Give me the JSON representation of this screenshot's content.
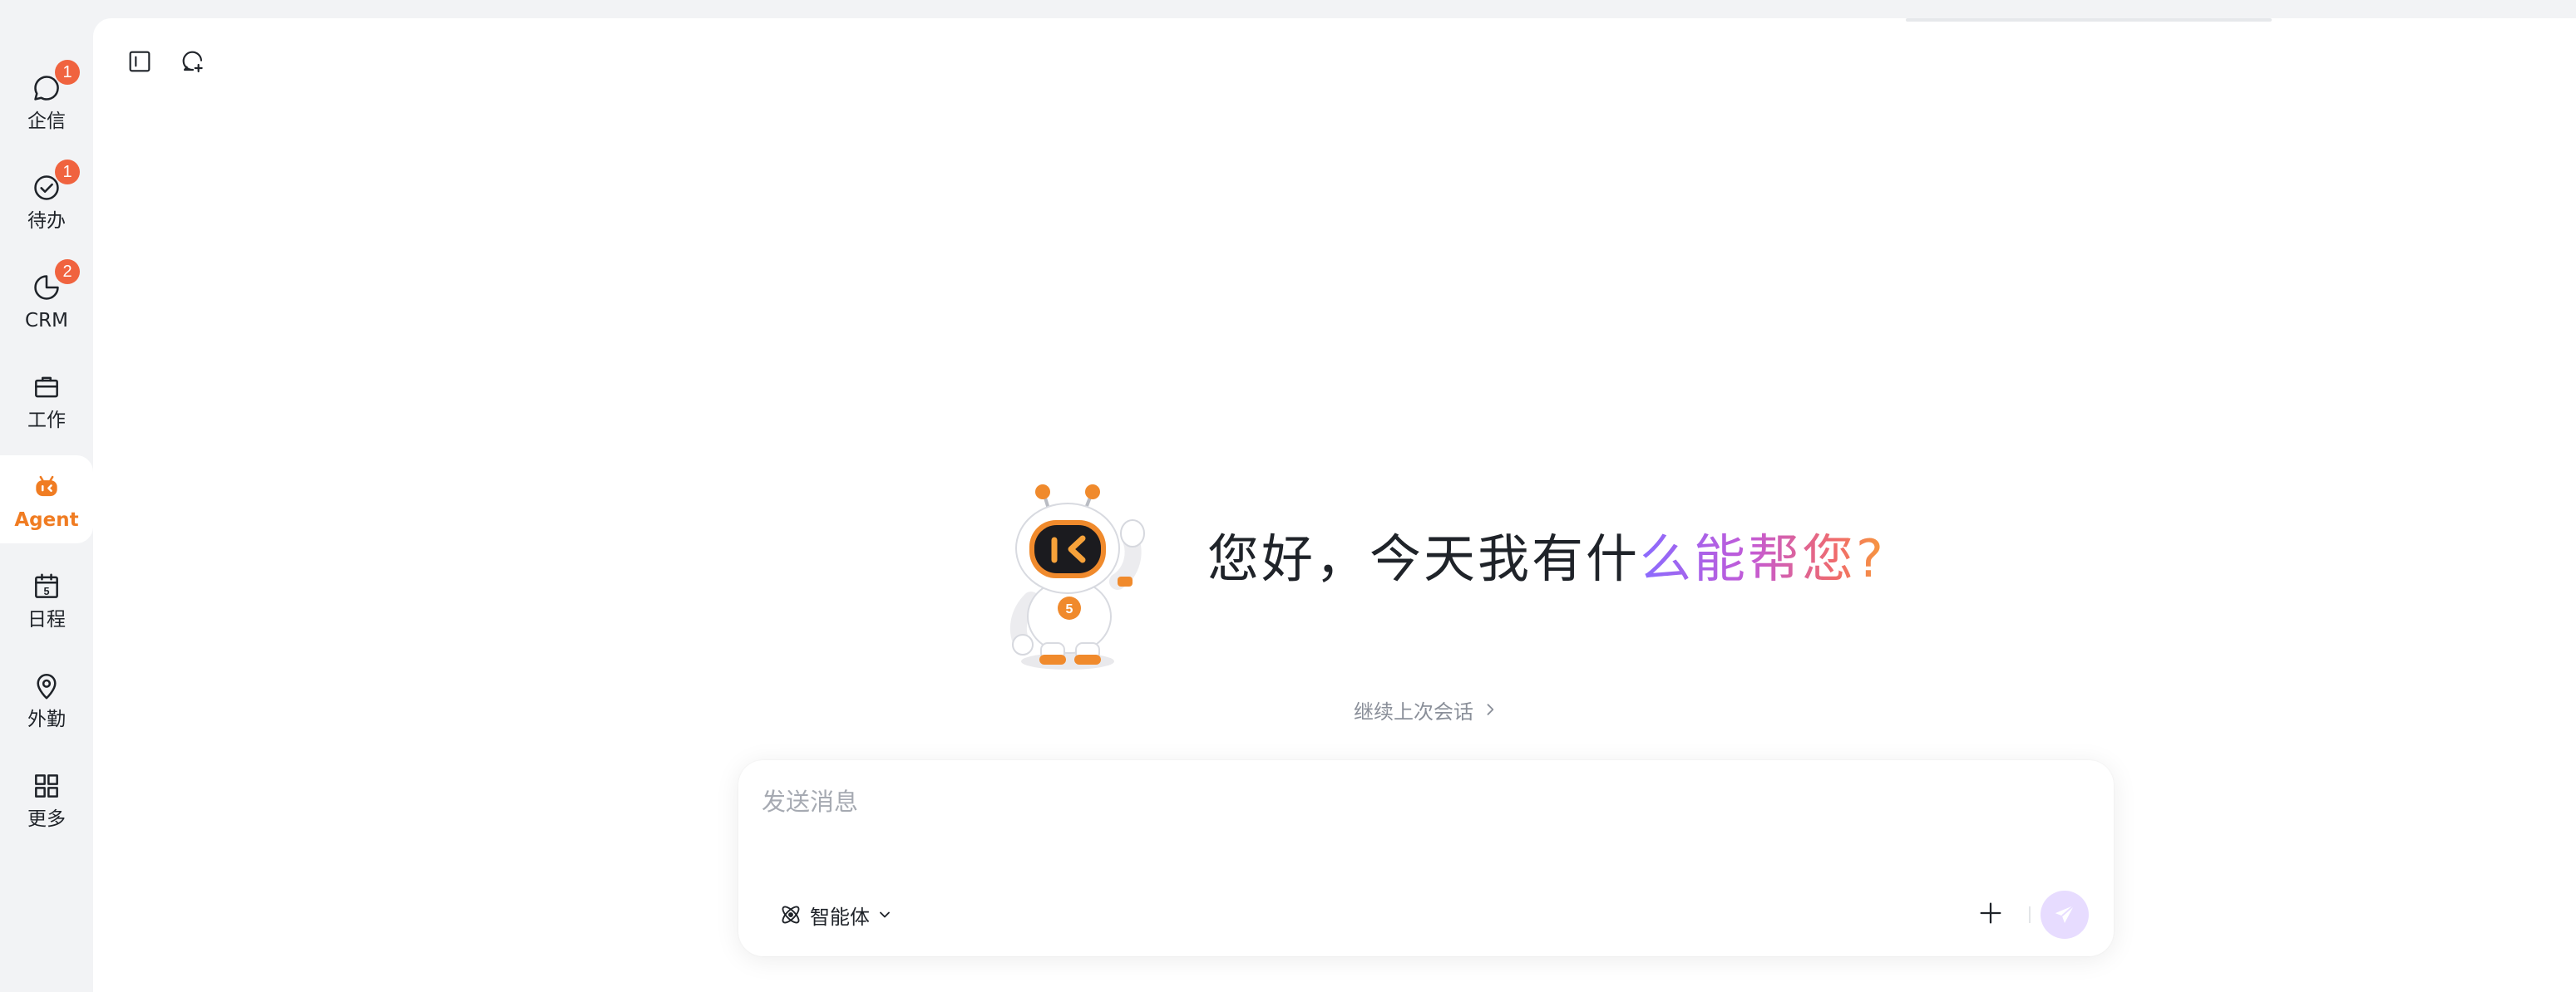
{
  "rail": {
    "items": [
      {
        "key": "messages",
        "label": "企信",
        "badge": "1",
        "icon": "chat-bubble-icon"
      },
      {
        "key": "todo",
        "label": "待办",
        "badge": "1",
        "icon": "check-circle-icon"
      },
      {
        "key": "crm",
        "label": "CRM",
        "badge": "2",
        "icon": "pie-chart-icon"
      },
      {
        "key": "work",
        "label": "工作",
        "icon": "briefcase-icon"
      },
      {
        "key": "agent",
        "label": "Agent",
        "icon": "robot-icon",
        "active": true
      },
      {
        "key": "schedule",
        "label": "日程",
        "icon": "calendar-icon",
        "calendar_day": "5"
      },
      {
        "key": "field",
        "label": "外勤",
        "icon": "location-pin-icon"
      },
      {
        "key": "more",
        "label": "更多",
        "icon": "grid-icon"
      }
    ]
  },
  "toolbar": {
    "icons": [
      "sidebar-toggle-icon",
      "new-chat-icon"
    ]
  },
  "greeting": {
    "plain": "您好，今天我有什",
    "highlight": "么能帮您?"
  },
  "continue_link": {
    "label": "继续上次会话"
  },
  "composer": {
    "placeholder": "发送消息",
    "value": "",
    "agent_label": "智能体"
  },
  "colors": {
    "accent": "#f07c22",
    "badge": "#f0633f",
    "send_button": "#e7dcff",
    "gradient": [
      "#8a6cff",
      "#c35ad6",
      "#f06b6b",
      "#f79a3a"
    ]
  }
}
